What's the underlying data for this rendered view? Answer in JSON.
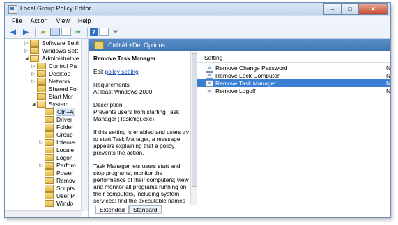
{
  "window": {
    "title": "Local Group Policy Editor",
    "buttons": {
      "minimize": "–",
      "maximize": "□",
      "close": "✕"
    }
  },
  "menu": [
    "File",
    "Action",
    "View",
    "Help"
  ],
  "toolbar": {
    "icons": [
      "back-arrow-icon",
      "forward-arrow-icon",
      "up-folder-icon",
      "show-hide-tree-icon",
      "properties-icon",
      "export-list-icon",
      "help-icon",
      "view-icon",
      "filter-icon"
    ]
  },
  "tree": {
    "items": [
      {
        "label": "Software Setti",
        "arrow": "▷"
      },
      {
        "label": "Windows Sett",
        "arrow": "▷"
      },
      {
        "label": "Administrative",
        "arrow": "◢"
      },
      {
        "label": "Control Pa",
        "arrow": "▷"
      },
      {
        "label": "Desktop",
        "arrow": "▷"
      },
      {
        "label": "Network",
        "arrow": "▷"
      },
      {
        "label": "Shared Fol",
        "arrow": ""
      },
      {
        "label": "Start Mer",
        "arrow": ""
      },
      {
        "label": "System",
        "arrow": "◢"
      },
      {
        "label": "Ctrl+A",
        "arrow": ""
      },
      {
        "label": "Driver",
        "arrow": ""
      },
      {
        "label": "Folder",
        "arrow": ""
      },
      {
        "label": "Group",
        "arrow": ""
      },
      {
        "label": "Interne",
        "arrow": "▷"
      },
      {
        "label": "Locale",
        "arrow": ""
      },
      {
        "label": "Logon",
        "arrow": ""
      },
      {
        "label": "Perforn",
        "arrow": "▷"
      },
      {
        "label": "Power",
        "arrow": ""
      },
      {
        "label": "Remov",
        "arrow": ""
      },
      {
        "label": "Scripts",
        "arrow": ""
      },
      {
        "label": "User P",
        "arrow": ""
      },
      {
        "label": "Windo",
        "arrow": ""
      }
    ]
  },
  "content": {
    "header_title": "Ctrl+Alt+Del Options",
    "description": {
      "title": "Remove Task Manager",
      "edit_prefix": "Edit",
      "edit_link": "policy setting",
      "requirements_label": "Requirements:",
      "requirements_value": "At least Windows 2000",
      "description_label": "Description:",
      "p1": "Prevents users from starting Task Manager (Taskmgr.exe).",
      "p2": "If this setting is enabled and users try to start Task Manager, a message appears explaining that a policy prevents the action.",
      "p3": "Task Manager lets users start and stop programs; monitor the performance of their computers; view and monitor all programs running on their computers, including system services; find the executable names of programs; and change the priority of the"
    },
    "list": {
      "column_setting": "Setting",
      "rows": [
        {
          "label": "Remove Change Password",
          "state": "Not"
        },
        {
          "label": "Remove Lock Computer",
          "state": "Not"
        },
        {
          "label": "Remove Task Manager",
          "state": "Not"
        },
        {
          "label": "Remove Logoff",
          "state": "Not"
        }
      ]
    },
    "tabs": [
      "Extended",
      "Standard"
    ]
  }
}
